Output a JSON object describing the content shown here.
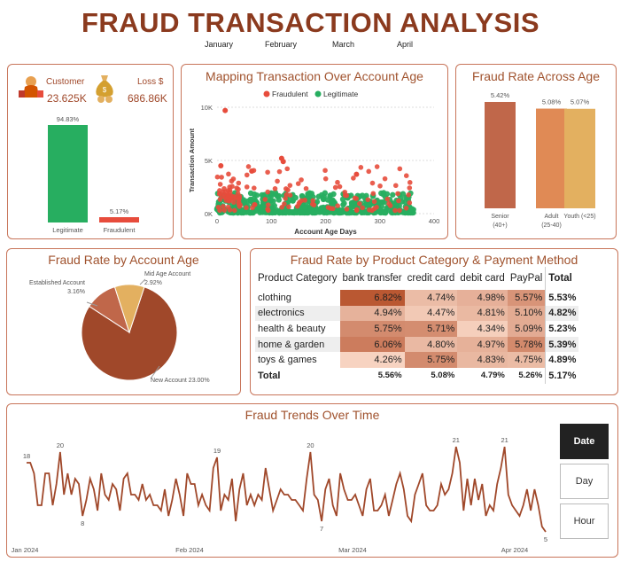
{
  "title": "FRAUD TRANSACTION ANALYSIS",
  "months": [
    "January",
    "February",
    "March",
    "April"
  ],
  "kpi": {
    "customer_label": "Customer",
    "customer_value": "23.625K",
    "loss_label": "Loss $",
    "loss_value": "686.86K",
    "customer_icon": "shopper-icon",
    "loss_icon": "money-bag-icon",
    "chart_data": {
      "type": "bar",
      "categories": [
        "Legitimate",
        "Fraudulent"
      ],
      "values": [
        94.83,
        5.17
      ],
      "data_labels": [
        "94.83%",
        "5.17%"
      ],
      "colors": [
        "#27ae60",
        "#e74c3c"
      ]
    }
  },
  "scatter": {
    "title": "Mapping Transaction Over Account Age",
    "chart_data": {
      "type": "scatter",
      "xlabel": "Account Age Days",
      "ylabel": "Transaction Amount",
      "xlim": [
        0,
        400
      ],
      "ylim": [
        0,
        10000
      ],
      "x_ticks": [
        "0",
        "100",
        "200",
        "300",
        "400"
      ],
      "y_ticks": [
        "0K",
        "5K",
        "10K"
      ],
      "series": [
        {
          "name": "Fraudulent",
          "color": "#e74c3c"
        },
        {
          "name": "Legitimate",
          "color": "#27ae60"
        }
      ]
    }
  },
  "age": {
    "title": "Fraud Rate Across Age",
    "chart_data": {
      "type": "bar",
      "categories": [
        "Senior (40+)",
        "Adult (25-40)",
        "Youth (<25)"
      ],
      "category_lines": [
        [
          "Senior",
          "(40+)"
        ],
        [
          "Adult",
          "(25-40)"
        ],
        [
          "Youth (<25)"
        ]
      ],
      "values": [
        5.42,
        5.08,
        5.07
      ],
      "data_labels": [
        "5.42%",
        "5.08%",
        "5.07%"
      ],
      "colors": [
        "#c0674a",
        "#e08a55",
        "#e3b060"
      ]
    }
  },
  "pie": {
    "title": "Fraud Rate by Account Age",
    "chart_data": {
      "type": "pie",
      "categories": [
        "New Account",
        "Established Account",
        "Mid Age Account"
      ],
      "values": [
        23.0,
        3.16,
        2.92
      ],
      "labels": [
        "New Account 23.00%",
        "Established Account",
        "3.16%",
        "Mid Age Account",
        "2.92%"
      ],
      "colors": [
        "#a0482a",
        "#c0674a",
        "#e3b060"
      ]
    }
  },
  "heatmap": {
    "title": "Fraud Rate by Product Category & Payment Method",
    "chart_data": {
      "type": "heatmap",
      "columns": [
        "Product Category",
        "bank transfer",
        "credit card",
        "debit card",
        "PayPal",
        "Total"
      ],
      "rows": [
        {
          "cat": "clothing",
          "vals": [
            "6.82%",
            "4.74%",
            "4.98%",
            "5.57%"
          ],
          "raw": [
            6.82,
            4.74,
            4.98,
            5.57
          ],
          "total": "5.53%"
        },
        {
          "cat": "electronics",
          "vals": [
            "4.94%",
            "4.47%",
            "4.81%",
            "5.10%"
          ],
          "raw": [
            4.94,
            4.47,
            4.81,
            5.1
          ],
          "total": "4.82%"
        },
        {
          "cat": "health & beauty",
          "vals": [
            "5.75%",
            "5.71%",
            "4.34%",
            "5.09%"
          ],
          "raw": [
            5.75,
            5.71,
            4.34,
            5.09
          ],
          "total": "5.23%"
        },
        {
          "cat": "home & garden",
          "vals": [
            "6.06%",
            "4.80%",
            "4.97%",
            "5.78%"
          ],
          "raw": [
            6.06,
            4.8,
            4.97,
            5.78
          ],
          "total": "5.39%"
        },
        {
          "cat": "toys & games",
          "vals": [
            "4.26%",
            "5.75%",
            "4.83%",
            "4.75%"
          ],
          "raw": [
            4.26,
            5.75,
            4.83,
            4.75
          ],
          "total": "4.89%"
        }
      ],
      "total_row": {
        "cat": "Total",
        "vals": [
          "5.56%",
          "5.08%",
          "4.79%",
          "5.26%"
        ],
        "total": "5.17%"
      }
    }
  },
  "trend": {
    "title": "Fraud Trends Over Time",
    "chart_data": {
      "type": "line",
      "x_ticks": [
        "Jan 2024",
        "Feb 2024",
        "Mar 2024",
        "Apr 2024"
      ],
      "values": [
        18,
        18,
        16,
        10,
        10,
        16,
        16,
        10,
        14,
        20,
        12,
        16,
        12,
        15,
        14,
        8,
        11,
        15,
        13,
        9,
        16,
        12,
        11,
        14,
        13,
        9,
        15,
        16,
        12,
        12,
        11,
        14,
        11,
        12,
        10,
        10,
        9,
        13,
        8,
        11,
        15,
        12,
        8,
        16,
        14,
        14,
        10,
        12,
        10,
        9,
        17,
        19,
        9,
        12,
        11,
        15,
        7,
        13,
        16,
        10,
        12,
        10,
        12,
        11,
        17,
        13,
        9,
        11,
        13,
        12,
        12,
        11,
        11,
        10,
        9,
        15,
        20,
        12,
        11,
        7,
        13,
        15,
        10,
        8,
        16,
        13,
        11,
        11,
        12,
        10,
        8,
        13,
        15,
        9,
        9,
        10,
        12,
        8,
        11,
        14,
        16,
        13,
        8,
        7,
        12,
        14,
        16,
        10,
        9,
        9,
        10,
        14,
        12,
        13,
        16,
        21,
        18,
        9,
        15,
        10,
        15,
        11,
        14,
        8,
        10,
        9,
        14,
        17,
        21,
        12,
        10,
        9,
        8,
        10,
        13,
        9,
        13,
        10,
        6,
        5
      ],
      "point_labels": [
        {
          "i": 0,
          "text": "18"
        },
        {
          "i": 9,
          "text": "20"
        },
        {
          "i": 15,
          "text": "8"
        },
        {
          "i": 51,
          "text": "19"
        },
        {
          "i": 76,
          "text": "20"
        },
        {
          "i": 79,
          "text": "7"
        },
        {
          "i": 115,
          "text": "21"
        },
        {
          "i": 128,
          "text": "21"
        },
        {
          "i": 139,
          "text": "5"
        }
      ],
      "line_color": "#a0482a"
    }
  },
  "slicer": {
    "buttons": [
      "Date",
      "Day",
      "Hour"
    ],
    "active": "Date"
  }
}
